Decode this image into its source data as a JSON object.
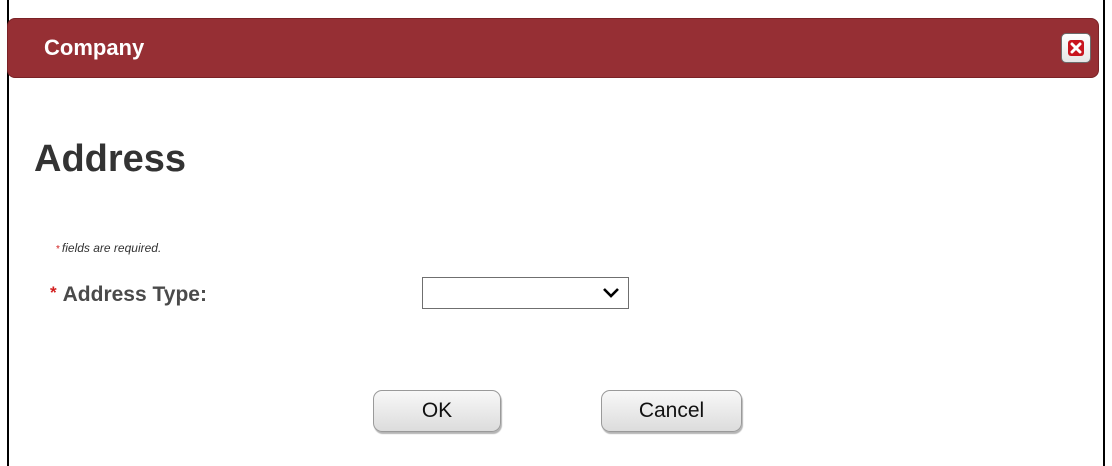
{
  "dialog": {
    "title": "Company",
    "close_icon": "close-icon"
  },
  "form": {
    "heading": "Address",
    "required_note_star": "*",
    "required_note": "fields are required.",
    "address_type": {
      "required_star": "*",
      "label": "Address Type:",
      "selected_value": "",
      "dropdown_icon": "chevron-down-icon"
    }
  },
  "buttons": {
    "ok_label": "OK",
    "cancel_label": "Cancel"
  },
  "colors": {
    "title_bar": "#962f34",
    "required_star": "#d21e1e",
    "close_icon": "#c8141e"
  }
}
